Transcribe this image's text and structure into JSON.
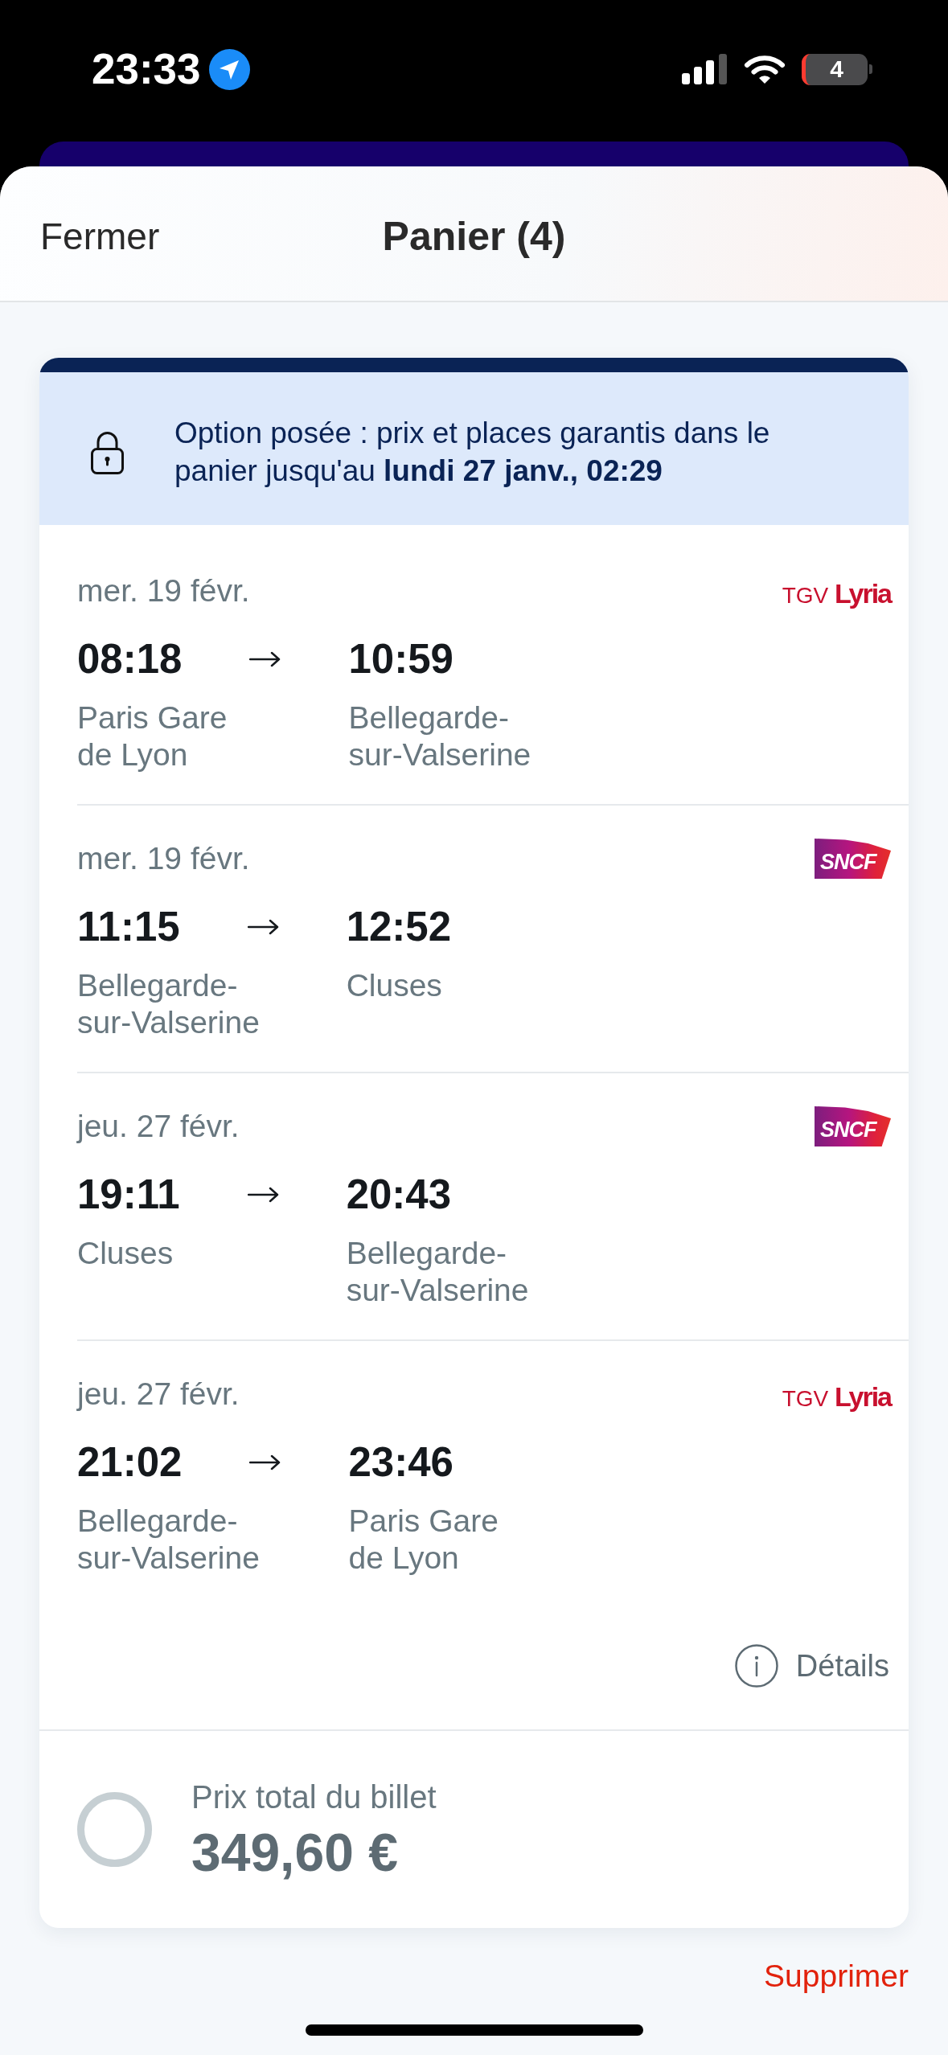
{
  "status_bar": {
    "time": "23:33",
    "battery": "4"
  },
  "header": {
    "close": "Fermer",
    "title": "Panier (4)"
  },
  "banner": {
    "text": "Option posée : prix et places garantis dans le panier jusqu'au **lundi 27 janv., 02:29**"
  },
  "trips": [
    {
      "date": "mer. 19 févr.",
      "operator": {
        "kind": "lyria",
        "logo": "TGV **Lyria**"
      },
      "departure": {
        "time": "08:18",
        "station": "Paris Gare de Lyon"
      },
      "arrival": {
        "time": "10:59",
        "station": "Bellegarde-sur-Valserine"
      }
    },
    {
      "date": "mer. 19 févr.",
      "operator": {
        "kind": "sncf",
        "logo": "SNCF"
      },
      "departure": {
        "time": "11:15",
        "station": "Bellegarde-sur-Valserine"
      },
      "arrival": {
        "time": "12:52",
        "station": "Cluses"
      }
    },
    {
      "date": "jeu. 27 févr.",
      "operator": {
        "kind": "sncf",
        "logo": "SNCF"
      },
      "departure": {
        "time": "19:11",
        "station": "Cluses"
      },
      "arrival": {
        "time": "20:43",
        "station": "Bellegarde-sur-Valserine"
      }
    },
    {
      "date": "jeu. 27 févr.",
      "operator": {
        "kind": "lyria",
        "logo": "TGV **Lyria**"
      },
      "departure": {
        "time": "21:02",
        "station": "Bellegarde-sur-Valserine"
      },
      "arrival": {
        "time": "23:46",
        "station": "Paris Gare de Lyon"
      }
    }
  ],
  "details": {
    "label": "Détails"
  },
  "total": {
    "selected": false,
    "label": "Prix total du billet",
    "price": "349,60 €"
  },
  "actions": {
    "delete": "Supprimer"
  }
}
